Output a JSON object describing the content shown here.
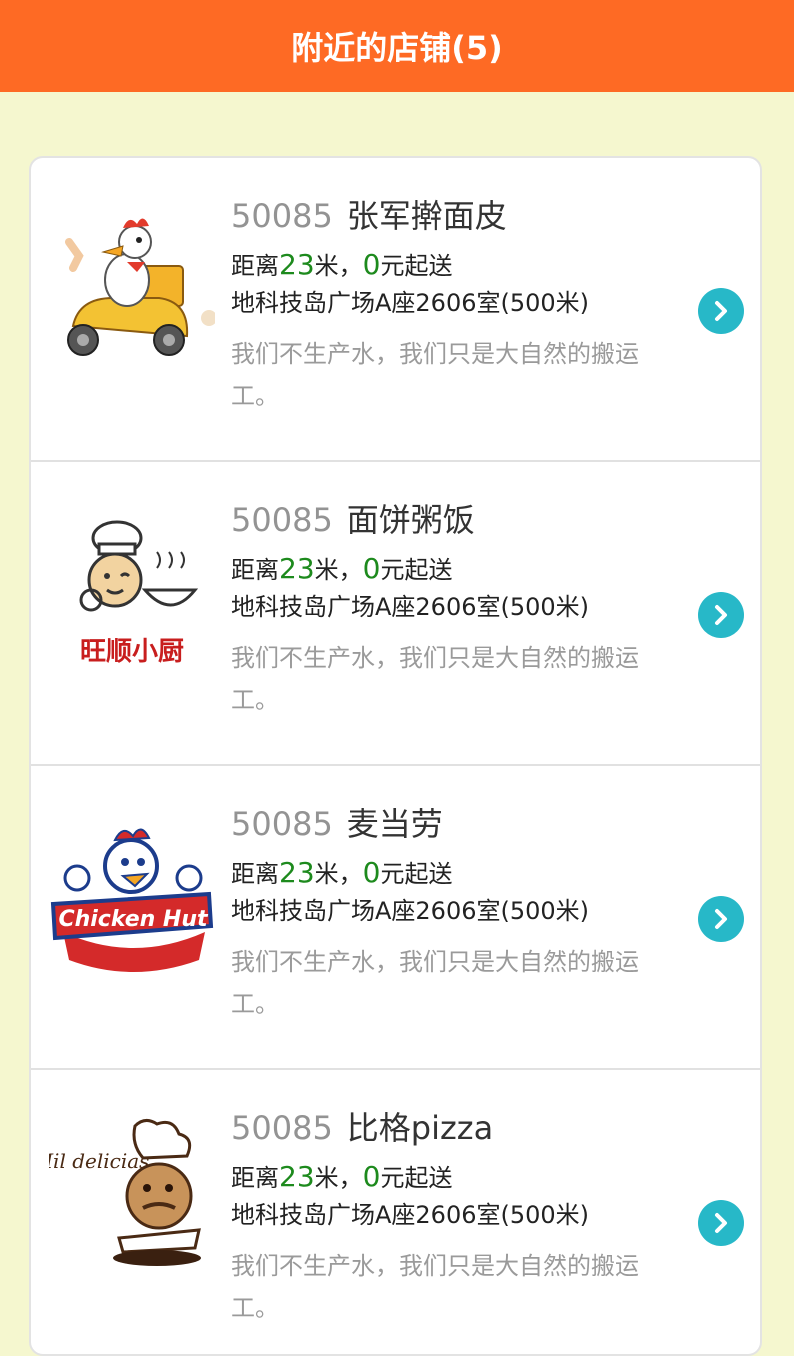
{
  "header": {
    "title": "附近的店铺(5)"
  },
  "shops": [
    {
      "id": "50085",
      "name": "张军擀面皮",
      "distance_prefix": "距离",
      "distance": "23",
      "distance_unit": "米，",
      "min_order": "0",
      "min_order_suffix": "元起送",
      "address": "地科技岛广场A座2606室(500米)",
      "slogan": "我们不生产水，我们只是大自然的搬运工。",
      "logo": "delivery-chicken-scooter"
    },
    {
      "id": "50085",
      "name": "面饼粥饭",
      "distance_prefix": "距离",
      "distance": "23",
      "distance_unit": "米，",
      "min_order": "0",
      "min_order_suffix": "元起送",
      "address": "地科技岛广场A座2606室(500米)",
      "slogan": "我们不生产水，我们只是大自然的搬运工。",
      "logo": "chef-bowl",
      "logo_text": "旺顺小厨"
    },
    {
      "id": "50085",
      "name": "麦当劳",
      "distance_prefix": "距离",
      "distance": "23",
      "distance_unit": "米，",
      "min_order": "0",
      "min_order_suffix": "元起送",
      "address": "地科技岛广场A座2606室(500米)",
      "slogan": "我们不生产水，我们只是大自然的搬运工。",
      "logo": "chicken-hut",
      "logo_text": "Chicken Hut"
    },
    {
      "id": "50085",
      "name": "比格pizza",
      "distance_prefix": "距离",
      "distance": "23",
      "distance_unit": "米，",
      "min_order": "0",
      "min_order_suffix": "元起送",
      "address": "地科技岛广场A座2606室(500米)",
      "slogan": "我们不生产水，我们只是大自然的搬运工。",
      "logo": "mil-delicias-chef",
      "logo_text": "Mil delicias"
    }
  ],
  "colors": {
    "header_bg": "#fe6a24",
    "page_bg": "#f5f7cf",
    "accent_green": "#1d8a1d",
    "arrow_teal": "#27b8c8"
  },
  "icons": {
    "arrow": "chevron-right-circle-icon"
  }
}
